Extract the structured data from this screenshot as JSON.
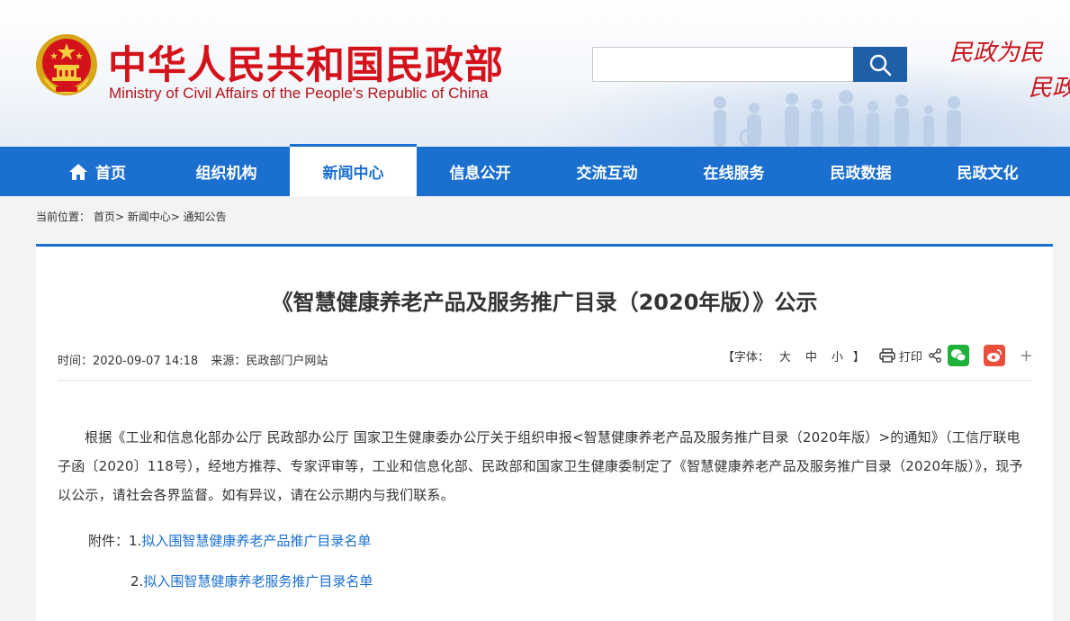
{
  "header": {
    "title_cn": "中华人民共和国民政部",
    "title_en": "Ministry of Civil Affairs of the People's Republic of China",
    "search_placeholder": "",
    "slogan_line1": "民政为民",
    "slogan_line2": "民政"
  },
  "nav": {
    "items": [
      {
        "label": "首页"
      },
      {
        "label": "组织机构"
      },
      {
        "label": "新闻中心"
      },
      {
        "label": "信息公开"
      },
      {
        "label": "交流互动"
      },
      {
        "label": "在线服务"
      },
      {
        "label": "民政数据"
      },
      {
        "label": "民政文化"
      }
    ],
    "active_index": 2
  },
  "breadcrumb": {
    "prefix": "当前位置：",
    "items": [
      "首页",
      "新闻中心",
      "通知公告"
    ],
    "sep": "> "
  },
  "article": {
    "title": "《智慧健康养老产品及服务推广目录（2020年版）》公示",
    "time_label": "时间：",
    "time_value": "2020-09-07 14:18",
    "source_label": "来源：",
    "source_value": "民政部门户网站",
    "font_size_label": "【字体：",
    "font_large": "大",
    "font_medium": "中",
    "font_small": "小",
    "font_close": "】",
    "print_label": "打印",
    "body": "根据《工业和信息化部办公厅 民政部办公厅 国家卫生健康委办公厅关于组织申报<智慧健康养老产品及服务推广目录（2020年版）>的通知》（工信厅联电子函〔2020〕118号），经地方推荐、专家评审等，工业和信息化部、民政部和国家卫生健康委制定了《智慧健康养老产品及服务推广目录（2020年版）》，现予以公示，请社会各界监督。如有异议，请在公示期内与我们联系。",
    "attachments_label": "附件：",
    "attachment1_num": "1.",
    "attachment1": "拟入围智慧健康养老产品推广目录名单",
    "attachment2_num": "2.",
    "attachment2": "拟入围智慧健康养老服务推广目录名单"
  },
  "colors": {
    "brand_red": "#d4121b",
    "nav_blue": "#1a6fcf",
    "link_blue": "#1a6fcf",
    "wechat_green": "#20b13a",
    "weibo_red": "#e8503d"
  }
}
